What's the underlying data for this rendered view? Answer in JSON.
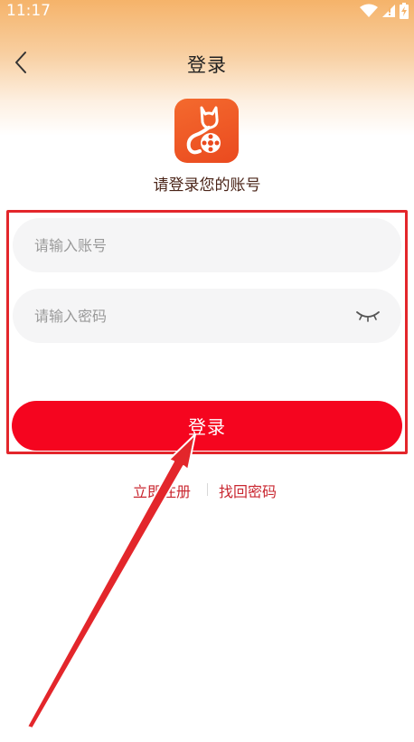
{
  "status_bar": {
    "time": "11:17",
    "icons": [
      "wifi-icon",
      "signal-icon",
      "battery-icon"
    ]
  },
  "nav": {
    "title": "登录",
    "back_icon": "chevron-left-icon"
  },
  "subtitle": "请登录您的账号",
  "form": {
    "account_placeholder": "请输入账号",
    "account_value": "",
    "password_placeholder": "请输入密码",
    "password_value": "",
    "password_toggle_icon": "eye-closed-icon",
    "login_label": "登录"
  },
  "links": {
    "register_label": "立即注册",
    "forgot_label": "找回密码"
  },
  "colors": {
    "accent": "#f5051f",
    "link": "#c92730",
    "annotation": "#e3262b",
    "logo": "#ea4a1f"
  }
}
